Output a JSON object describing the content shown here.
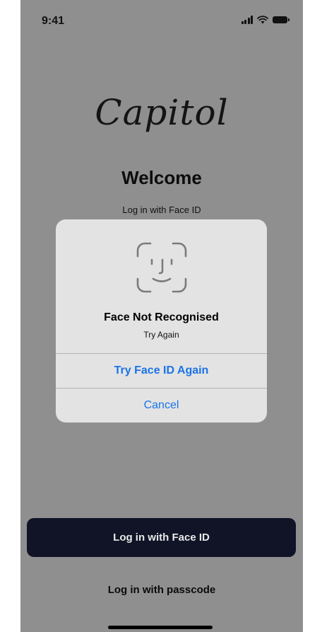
{
  "status_bar": {
    "time": "9:41",
    "icons": [
      "cellular-signal-icon",
      "wifi-icon",
      "battery-icon"
    ]
  },
  "brand": {
    "logo_text": "Capitol"
  },
  "header": {
    "title": "Welcome",
    "subtitle": "Log in with Face ID"
  },
  "dialog": {
    "icon": "face-id-icon",
    "title": "Face Not Recognised",
    "message": "Try Again",
    "retry_label": "Try Face ID Again",
    "cancel_label": "Cancel"
  },
  "actions": {
    "faceid_label": "Log in with Face ID",
    "passcode_label": "Log in with passcode"
  },
  "colors": {
    "overlay": "#8f8f8f",
    "dialog_bg": "#e3e3e3",
    "button_dark": "#101426",
    "link_blue": "#1a73e8"
  }
}
